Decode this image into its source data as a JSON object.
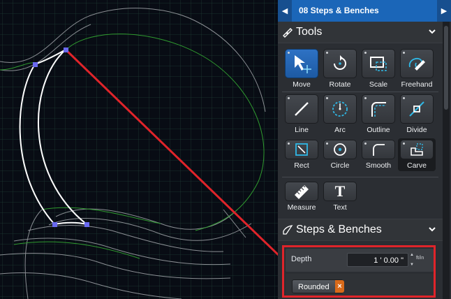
{
  "header": {
    "title": "08 Steps & Benches",
    "prev_arrow": "◀",
    "next_arrow": "▶"
  },
  "tools_section": {
    "title": "Tools",
    "icon": "edit-tools-icon"
  },
  "tools": [
    {
      "label": "Move",
      "icon": "move-icon",
      "active": true
    },
    {
      "label": "Rotate",
      "icon": "rotate-icon"
    },
    {
      "label": "Scale",
      "icon": "scale-icon"
    },
    {
      "label": "Freehand",
      "icon": "freehand-icon"
    },
    {
      "label": "Line",
      "icon": "line-icon"
    },
    {
      "label": "Arc",
      "icon": "arc-icon"
    },
    {
      "label": "Outline",
      "icon": "outline-icon"
    },
    {
      "label": "Divide",
      "icon": "divide-icon"
    },
    {
      "label": "Rect",
      "icon": "rect-icon"
    },
    {
      "label": "Circle",
      "icon": "circle-icon"
    },
    {
      "label": "Smooth",
      "icon": "smooth-icon"
    },
    {
      "label": "Carve",
      "icon": "carve-icon",
      "selected": true
    },
    {
      "label": "Measure",
      "icon": "ruler-icon"
    },
    {
      "label": "Text",
      "icon": "text-icon",
      "glyph": "T"
    }
  ],
  "steps_section": {
    "title": "Steps & Benches",
    "depth_label": "Depth",
    "depth_value": "1 ' 0.00 \"",
    "unit_label": "ft/in",
    "chip_label": "Rounded",
    "chip_remove": "×"
  },
  "colors": {
    "accent": "#1b66b8",
    "highlight": "#e0242a",
    "cyan": "#2fb8e6",
    "vertex": "#6a6af0"
  }
}
